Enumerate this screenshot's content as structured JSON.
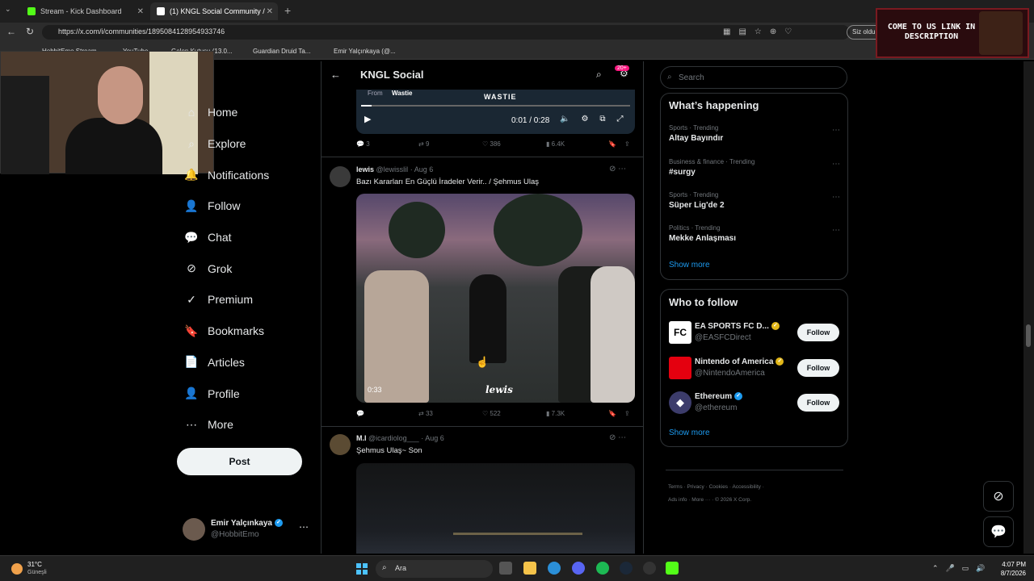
{
  "browser": {
    "tabs": [
      {
        "title": "Stream - Kick Dashboard",
        "close": "✕",
        "favicon_color": "#53fc18"
      },
      {
        "title": "(1) KNGL Social Community /",
        "close": "✕",
        "favicon_color": "#ffffff"
      }
    ],
    "new_tab": "+",
    "url": "https://x.com/i/communities/1895084128954933746",
    "profile_button": "Siz olduı",
    "bookmarks": [
      "HobbitEmo Stream",
      "YouTube",
      "Gelen Kutusu (13.0...",
      "Guardian Druid Ta...",
      "Emir Yalçınkaya (@..."
    ]
  },
  "overlay": {
    "promo_text": "COME TO US LINK IN DESCRIPTION",
    "webcam": "streamer-webcam"
  },
  "sidebar": {
    "items": [
      {
        "label": "Home",
        "icon": "home-icon",
        "glyph": "⌂"
      },
      {
        "label": "Explore",
        "icon": "search-icon",
        "glyph": "⌕"
      },
      {
        "label": "Notifications",
        "icon": "bell-icon",
        "glyph": "🔔"
      },
      {
        "label": "Follow",
        "icon": "person-plus-icon",
        "glyph": "👤"
      },
      {
        "label": "Chat",
        "icon": "chat-icon",
        "glyph": "💬"
      },
      {
        "label": "Grok",
        "icon": "grok-icon",
        "glyph": "⊘"
      },
      {
        "label": "Premium",
        "icon": "premium-icon",
        "glyph": "✓"
      },
      {
        "label": "Bookmarks",
        "icon": "bookmark-icon",
        "glyph": "🔖"
      },
      {
        "label": "Articles",
        "icon": "articles-icon",
        "glyph": "📄"
      },
      {
        "label": "Profile",
        "icon": "profile-icon",
        "glyph": "👤"
      },
      {
        "label": "More",
        "icon": "more-icon",
        "glyph": "⋯"
      }
    ],
    "post_label": "Post",
    "account": {
      "name": "Emir Yalçınkaya",
      "handle": "@HobbitEmo",
      "more": "⋯"
    }
  },
  "timeline": {
    "title": "KNGL Social",
    "badge": "20+",
    "video1": {
      "from_label": "From",
      "from_user": "Wastie",
      "watermark": "WASTIE",
      "time": "0:01 / 0:28",
      "progress": 0.04,
      "actions": {
        "replies": "3",
        "reposts": "9",
        "likes": "386",
        "views": "6.4K"
      }
    },
    "tweets": [
      {
        "name": "lewis",
        "handle": "@lewisslil",
        "date": "· Aug 6",
        "text": "Bazı Kararları En Güçlü İradeler Verir.. / Şehmus Ulaş",
        "video_time": "0:33",
        "watermark": "lewis",
        "actions": {
          "replies": "",
          "reposts": "33",
          "likes": "522",
          "views": "7.3K"
        }
      },
      {
        "name": "M.I",
        "handle": "@icardiolog___",
        "date": "· Aug 6",
        "text": "Şehmus Ulaş~ Son"
      }
    ]
  },
  "right": {
    "search_placeholder": "Search",
    "happening_title": "What’s happening",
    "trends": [
      {
        "category": "Sports · Trending",
        "topic": "Altay Bayındır"
      },
      {
        "category": "Business & finance · Trending",
        "topic": "#surgy"
      },
      {
        "category": "Sports · Trending",
        "topic": "Süper Lig'de 2"
      },
      {
        "category": "Politics · Trending",
        "topic": "Mekke Anlaşması"
      }
    ],
    "show_more": "Show more",
    "who_title": "Who to follow",
    "who": [
      {
        "name": "EA SPORTS FC D...",
        "handle": "@EASFCDirect",
        "follow": "Follow",
        "color": "#ffffff"
      },
      {
        "name": "Nintendo of America",
        "handle": "@NintendoAmerica",
        "follow": "Follow",
        "color": "#e4000f"
      },
      {
        "name": "Ethereum",
        "handle": "@ethereum",
        "follow": "Follow",
        "color": "#3c3c6b"
      }
    ],
    "show_more_2": "Show more",
    "footer": [
      "Terms",
      "Privacy",
      "Cookies",
      "Accessibility",
      "Ads info",
      "More ···",
      "© 2026 X Corp."
    ]
  },
  "taskbar": {
    "weather_temp": "31°C",
    "weather_desc": "Güneşli",
    "search": "Ara",
    "time": "4:07 PM",
    "date": "8/7/2026"
  }
}
